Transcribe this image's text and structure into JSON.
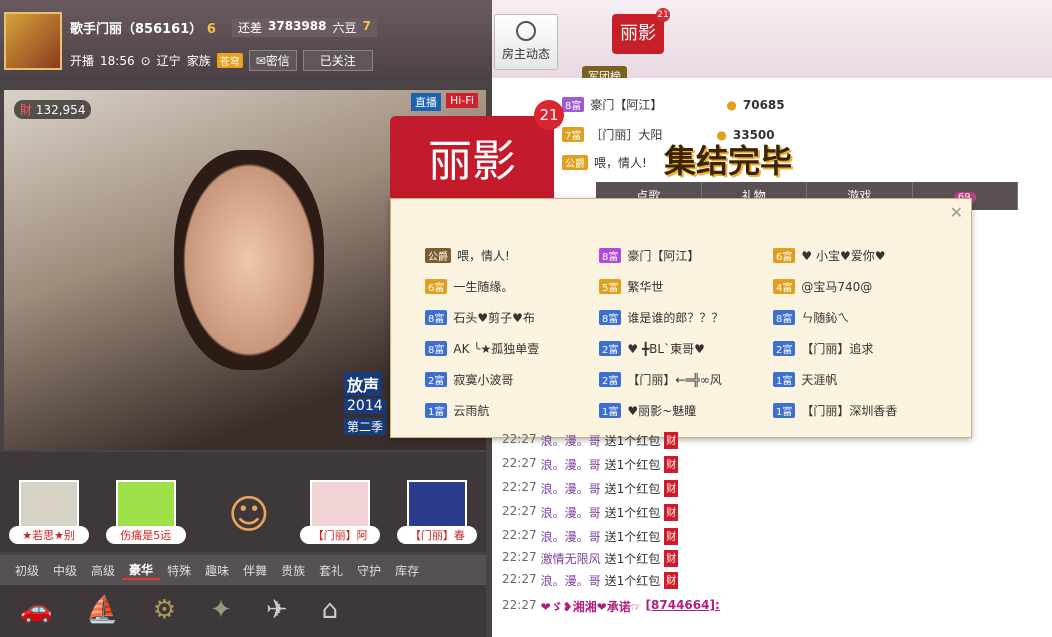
{
  "host": {
    "name": "歌手门丽（856161）",
    "level": "6",
    "time_label": "开播",
    "time": "18:56",
    "location": "辽宁",
    "family_label": "家族",
    "family_badge": "苍穹",
    "message_btn": "密信",
    "follow_btn": "已关注",
    "distance_label": "还差",
    "distance_value": "3783988",
    "distance_unit": "六豆",
    "next_level": "7"
  },
  "host_dynamic": {
    "label": "房主动态"
  },
  "flag": {
    "text": "丽影",
    "count": "21",
    "tab": "军团榜"
  },
  "video": {
    "viewers": "132,954",
    "live_tag": "直播",
    "hifi_tag": "Hi-Fi",
    "overlay_1": "放声",
    "overlay_2": "2014",
    "overlay_3": "第二季"
  },
  "guests": [
    {
      "caption": "★若思★别"
    },
    {
      "caption": "伤痛是5远"
    },
    {
      "caption": ""
    },
    {
      "caption": "【门丽】阿"
    },
    {
      "caption": "【门丽】春"
    }
  ],
  "categories": [
    "初级",
    "中级",
    "高级",
    "豪华",
    "特殊",
    "趣味",
    "伴舞",
    "贵族",
    "套礼",
    "守护",
    "库存"
  ],
  "active_category": "豪华",
  "rank": [
    {
      "lv": "8富",
      "name": "豪门【阿江】",
      "coins": "70685"
    },
    {
      "lv": "7富",
      "name": "［门丽］大阳",
      "coins": "33500"
    },
    {
      "lv": "公爵",
      "name": "喂，情人!",
      "coins": ""
    }
  ],
  "tabs": [
    "点歌",
    "礼物",
    "游戏",
    "69"
  ],
  "banner": {
    "flag": "丽影",
    "count": "21",
    "title": "集结完毕"
  },
  "members": [
    {
      "lv": "公爵",
      "name": "喂，情人!",
      "c": "k"
    },
    {
      "lv": "8富",
      "name": "豪门【阿江】",
      "c": "p"
    },
    {
      "lv": "6富",
      "name": "♥ 小宝♥爱你♥",
      "c": "g"
    },
    {
      "lv": "6富",
      "name": "一生随缘。",
      "c": "g"
    },
    {
      "lv": "5富",
      "name": "繁华世",
      "c": "g"
    },
    {
      "lv": "4富",
      "name": "@宝马740@",
      "c": "g"
    },
    {
      "lv": "8富",
      "name": "石头♥剪子♥布",
      "c": ""
    },
    {
      "lv": "8富",
      "name": "谁是谁的郎？？？",
      "c": ""
    },
    {
      "lv": "8富",
      "name": "ㄣ随鈊ㄟ",
      "c": ""
    },
    {
      "lv": "8富",
      "name": "AK ╰★孤独单壹",
      "c": ""
    },
    {
      "lv": "2富",
      "name": "♥ ╋BL`東哥♥",
      "c": ""
    },
    {
      "lv": "2富",
      "name": "【门丽】追求",
      "c": ""
    },
    {
      "lv": "2富",
      "name": "寂寞小波哥",
      "c": ""
    },
    {
      "lv": "2富",
      "name": "【门丽】←═╬∞风",
      "c": ""
    },
    {
      "lv": "1富",
      "name": "天涯帆",
      "c": ""
    },
    {
      "lv": "1富",
      "name": "云雨航",
      "c": ""
    },
    {
      "lv": "1富",
      "name": "♥丽影~魅瞳",
      "c": ""
    },
    {
      "lv": "1富",
      "name": "【门丽】深圳香香",
      "c": ""
    }
  ],
  "chat": [
    {
      "t": "22:27",
      "n": "浪。漫。哥",
      "c": "送1个红包",
      "cai": "财"
    },
    {
      "t": "22:27",
      "n": "浪。漫。哥",
      "c": "送1个红包",
      "cai": "财"
    },
    {
      "t": "22:27",
      "n": "浪。漫。哥",
      "c": "送1个红包",
      "cai": "财"
    },
    {
      "t": "22:27",
      "n": "浪。漫。哥",
      "c": "送1个红包",
      "cai": "财"
    },
    {
      "t": "22:27",
      "n": "浪。漫。哥",
      "c": "送1个红包",
      "cai": "财"
    },
    {
      "t": "22:27",
      "n": "激情无限风",
      "c": "送1个红包",
      "cai": "财"
    },
    {
      "t": "22:27",
      "n": "浪。漫。哥",
      "c": "送1个红包",
      "cai": "财"
    }
  ],
  "last_line": {
    "t": "22:27",
    "n": "❤ゞ❥湘湘❤承诺☞",
    "id": "[8744664]:"
  }
}
